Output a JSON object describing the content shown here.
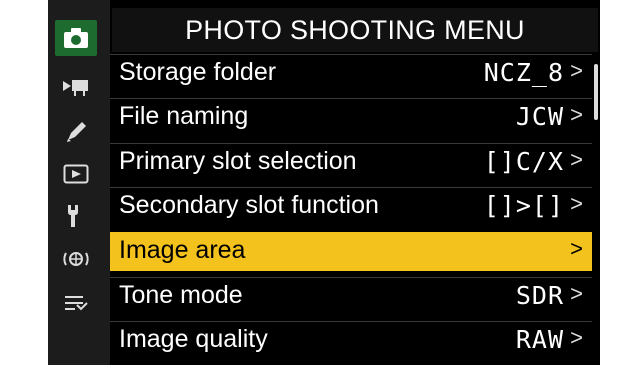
{
  "header": {
    "title": "PHOTO SHOOTING MENU"
  },
  "tabs": [
    {
      "icon": "camera-icon",
      "active": true
    },
    {
      "icon": "movie-camera-icon",
      "active": false
    },
    {
      "icon": "pencil-icon",
      "active": false
    },
    {
      "icon": "playback-icon",
      "active": false
    },
    {
      "icon": "wrench-icon",
      "active": false
    },
    {
      "icon": "network-icon",
      "active": false
    },
    {
      "icon": "my-menu-icon",
      "active": false
    }
  ],
  "menu": {
    "items": [
      {
        "label": "Storage folder",
        "value": "NCZ_8",
        "chevron": ">"
      },
      {
        "label": "File naming",
        "value": "JCW",
        "chevron": ">"
      },
      {
        "label": "Primary slot selection",
        "value": "[]C/X",
        "chevron": ">"
      },
      {
        "label": "Secondary slot function",
        "value": "[]>[]",
        "chevron": ">"
      },
      {
        "label": "Image area",
        "value": "",
        "chevron": ">",
        "selected": true
      },
      {
        "label": "Tone mode",
        "value": "SDR",
        "chevron": ">"
      },
      {
        "label": "Image quality",
        "value": "RAW",
        "chevron": ">"
      }
    ]
  },
  "colors": {
    "accent": "#f4c21c",
    "active_tab": "#1e6b2f",
    "background": "#000000"
  }
}
